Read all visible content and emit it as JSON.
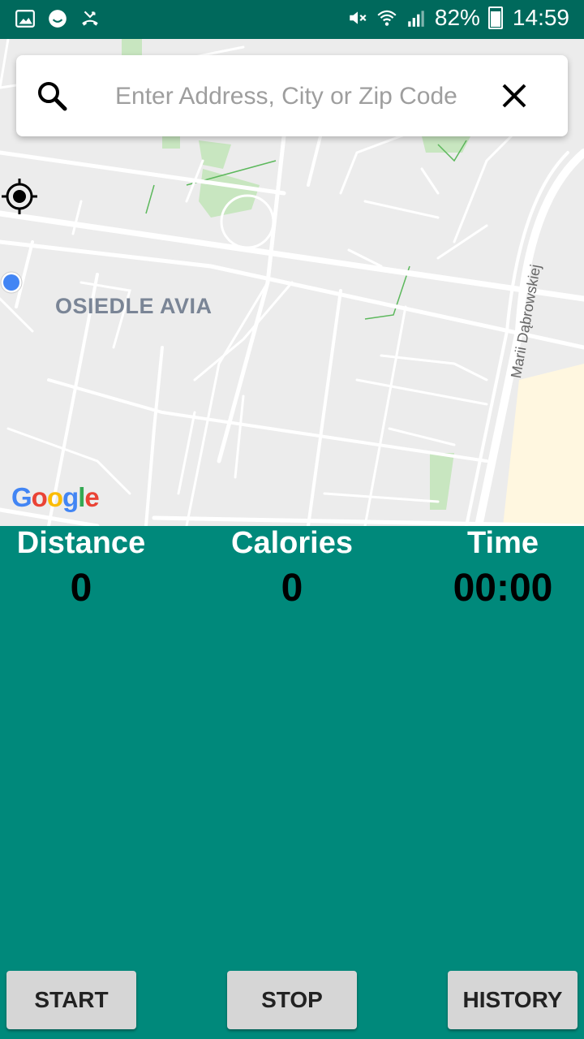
{
  "status_bar": {
    "battery_percent": "82%",
    "time": "14:59",
    "left_icons": [
      "image-icon",
      "smiley-icon",
      "missed-call-icon"
    ],
    "right_icons": [
      "mute-icon",
      "wifi-icon",
      "signal-icon",
      "battery-icon"
    ]
  },
  "map": {
    "search": {
      "placeholder": "Enter Address, City or Zip Code",
      "value": ""
    },
    "area_label": "OSIEDLE AVIA",
    "street_label": "Marii Dąbrowskiej",
    "attribution": "Google",
    "colors": {
      "background": "#ECECEC",
      "road": "#FFFFFF",
      "park": "#C8E6C0",
      "sand": "#FFF7E0",
      "user_dot": "#4285F4"
    }
  },
  "stats": {
    "distance": {
      "label": "Distance",
      "value": "0"
    },
    "calories": {
      "label": "Calories",
      "value": "0"
    },
    "time": {
      "label": "Time",
      "value": "00:00"
    }
  },
  "buttons": {
    "start": "START",
    "stop": "STOP",
    "history": "HISTORY"
  },
  "colors": {
    "status_bar": "#00695C",
    "panel": "#00897B",
    "button": "#D6D6D6"
  }
}
